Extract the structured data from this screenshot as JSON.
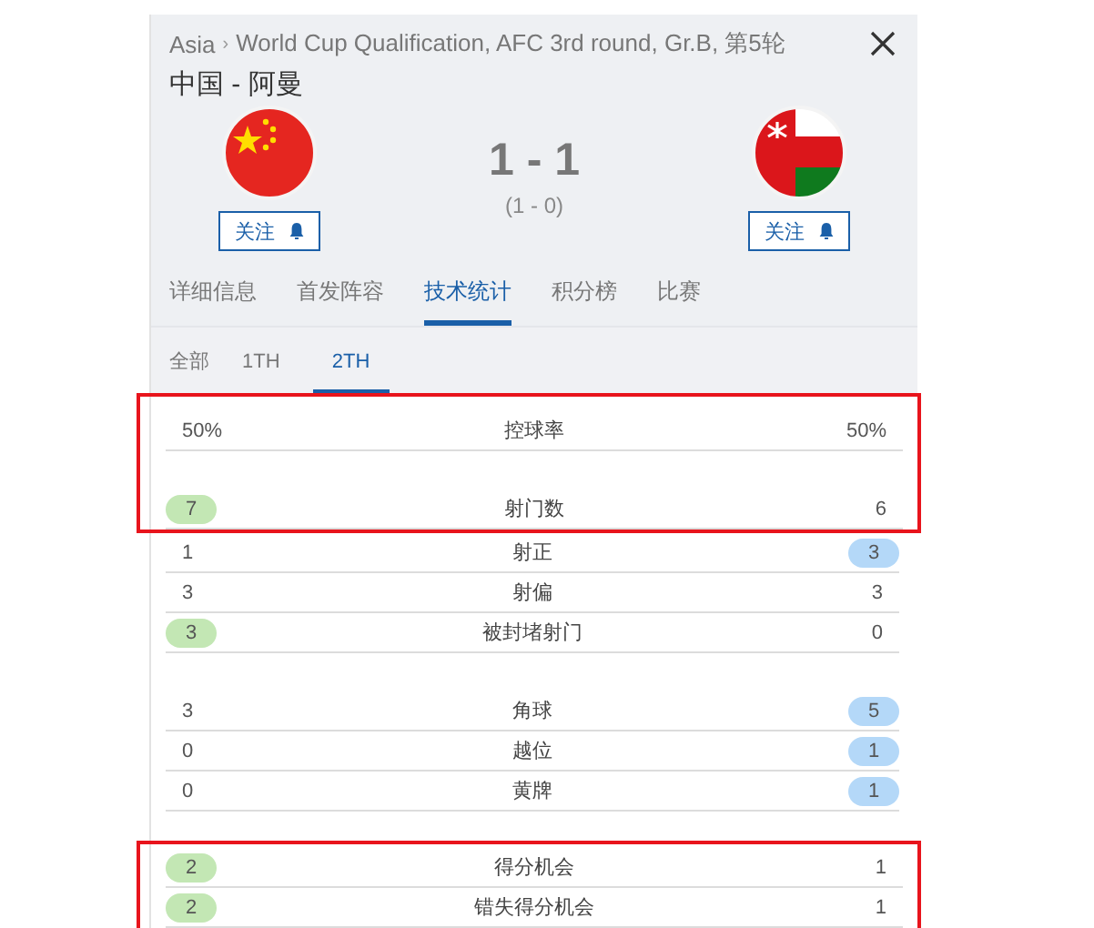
{
  "header": {
    "breadcrumb": [
      "Asia",
      "World Cup Qualification, AFC 3rd round, Gr.B, 第5轮"
    ],
    "separator": "›",
    "match": "中国 - 阿曼",
    "score": "1 - 1",
    "halftime": "(1 - 0)"
  },
  "teams": [
    {
      "follow": "关注"
    },
    {
      "follow": "关注"
    }
  ],
  "tabs": [
    {
      "label": "详细信息",
      "selected": false
    },
    {
      "label": "首发阵容",
      "selected": false
    },
    {
      "label": "技术统计",
      "selected": true
    },
    {
      "label": "积分榜",
      "selected": false
    },
    {
      "label": "比赛",
      "selected": false
    }
  ],
  "subtabs": [
    {
      "label": "全部",
      "selected": false
    },
    {
      "label": "1TH",
      "selected": false
    },
    {
      "label": "2TH",
      "selected": true
    }
  ],
  "blocks": [
    {
      "outlined": true,
      "groups": [
        [
          {
            "home": "50%",
            "label": "控球率",
            "away": "50%",
            "home_leads": false,
            "away_leads": false
          }
        ],
        [
          {
            "home": "7",
            "label": "射门数",
            "away": "6",
            "home_leads": true,
            "away_leads": false
          }
        ]
      ]
    },
    {
      "outlined": false,
      "groups": [
        [
          {
            "home": "1",
            "label": "射正",
            "away": "3",
            "home_leads": false,
            "away_leads": true
          },
          {
            "home": "3",
            "label": "射偏",
            "away": "3",
            "home_leads": false,
            "away_leads": false
          },
          {
            "home": "3",
            "label": "被封堵射门",
            "away": "0",
            "home_leads": true,
            "away_leads": false
          }
        ],
        [
          {
            "home": "3",
            "label": "角球",
            "away": "5",
            "home_leads": false,
            "away_leads": true
          },
          {
            "home": "0",
            "label": "越位",
            "away": "1",
            "home_leads": false,
            "away_leads": true
          },
          {
            "home": "0",
            "label": "黄牌",
            "away": "1",
            "home_leads": false,
            "away_leads": true
          }
        ]
      ]
    },
    {
      "outlined": true,
      "groups": [
        [
          {
            "home": "2",
            "label": "得分机会",
            "away": "1",
            "home_leads": true,
            "away_leads": false
          },
          {
            "home": "2",
            "label": "错失得分机会",
            "away": "1",
            "home_leads": true,
            "away_leads": false
          }
        ]
      ]
    }
  ]
}
